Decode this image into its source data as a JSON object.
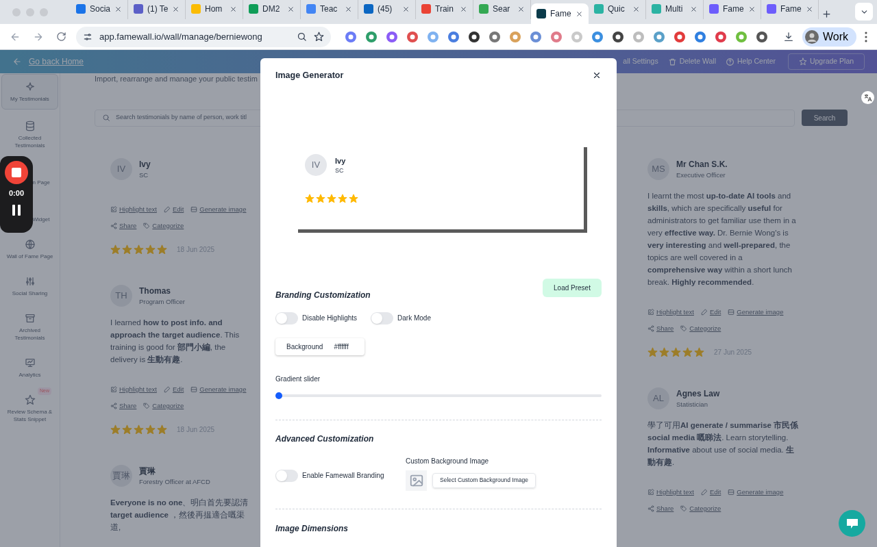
{
  "browser": {
    "tabs": [
      {
        "title": "Socia",
        "selected": false
      },
      {
        "title": "(1) Te",
        "selected": false
      },
      {
        "title": "Hom",
        "selected": false
      },
      {
        "title": "DM2",
        "selected": false
      },
      {
        "title": "Teac",
        "selected": false
      },
      {
        "title": "(45)",
        "selected": false
      },
      {
        "title": "Train",
        "selected": false
      },
      {
        "title": "Sear",
        "selected": false
      },
      {
        "title": "Fame",
        "selected": true
      },
      {
        "title": "Quic",
        "selected": false
      },
      {
        "title": "Multi",
        "selected": false
      },
      {
        "title": "Fame",
        "selected": false
      },
      {
        "title": "Fame",
        "selected": false
      }
    ],
    "address": "app.famewall.io/wall/manage/berniewong",
    "profile": "Work"
  },
  "app_header": {
    "back_link": "Go back Home",
    "actions": [
      {
        "kind": "settings",
        "label": "all Settings"
      },
      {
        "kind": "delete",
        "label": "Delete Wall"
      },
      {
        "kind": "help",
        "label": "Help Center"
      }
    ],
    "upgrade": "Upgrade Plan"
  },
  "sidebar": {
    "items": [
      {
        "label": "My Testimonials",
        "selected": true
      },
      {
        "label": "Collected Testimonials",
        "selected": false
      },
      {
        "label": "n Page",
        "selected": false
      },
      {
        "label": "Widget",
        "selected": false
      },
      {
        "label": "Wall of Fame Page",
        "selected": false
      },
      {
        "label": "Social Sharing",
        "selected": false
      },
      {
        "label": "Archived Testimonials",
        "selected": false
      },
      {
        "label": "Analytics",
        "selected": false
      },
      {
        "label": "Review Schema & Stats Snippet",
        "selected": false,
        "badge": "New"
      }
    ]
  },
  "recorder": {
    "time": "0:00"
  },
  "main": {
    "subtitle": "Import, rearrange and manage your public testim",
    "search": {
      "placeholder": "Search testimonials by name of person, work titl",
      "button": "Search"
    },
    "columns": [
      [
        {
          "initials": "IV",
          "name": "Ivy",
          "role": "SC",
          "actions": [
            {
              "kind": "highlight",
              "label": "Highlight text"
            },
            {
              "kind": "edit",
              "label": "Edit"
            },
            {
              "kind": "generate",
              "label": "Generate image"
            },
            {
              "kind": "share",
              "label": "Share"
            },
            {
              "kind": "categorize",
              "label": "Categorize"
            }
          ],
          "stars": 5,
          "date": "18 Jun 2025"
        },
        {
          "initials": "TH",
          "name": "Thomas",
          "role": "Program Officer",
          "text": "I learned **how to post info. and approach the target audience**. This training is good for **部門小編**, the delivery is **生動有趣**.",
          "actions": [
            {
              "kind": "highlight",
              "label": "Highlight text"
            },
            {
              "kind": "edit",
              "label": "Edit"
            },
            {
              "kind": "generate",
              "label": "Generate image"
            },
            {
              "kind": "share",
              "label": "Share"
            },
            {
              "kind": "categorize",
              "label": "Categorize"
            }
          ],
          "stars": 5,
          "date": "18 Jun 2025"
        },
        {
          "initials": "賈琳",
          "name": "賈琳",
          "role": "Forestry Officer at AFCD",
          "text": "**Everyone is no one**、明白首先要認清 **target audience** ，然後再揾適合嘅渠道,"
        }
      ],
      [
        {
          "initials": "MS",
          "name": "Mr Chan S.K.",
          "role": "Executive Officer",
          "text": "I learnt the most **up-to-date AI tools** and **skills**, which are specifically **useful** for administrators to get familiar use them in a very **effective way.** Dr. Bernie Wong's is **very interesting** and **well-prepared**, the topics are well covered in a **comprehensive way** within a short lunch break. **Highly recommended**.",
          "actions": [
            {
              "kind": "highlight",
              "label": "Highlight text"
            },
            {
              "kind": "edit",
              "label": "Edit"
            },
            {
              "kind": "generate",
              "label": "Generate image"
            },
            {
              "kind": "share",
              "label": "Share"
            },
            {
              "kind": "categorize",
              "label": "Categorize"
            }
          ],
          "stars": 5,
          "date": "27 Jun 2025"
        },
        {
          "initials": "AL",
          "name": "Agnes Law",
          "role": "Statistician",
          "text": "學了可用**AI generate / summarise 市民係 social media 嘅睇法**. Learn storytelling. **Informative** about use of social media. **生動有趣**.",
          "actions": [
            {
              "kind": "highlight",
              "label": "Highlight text"
            },
            {
              "kind": "edit",
              "label": "Edit"
            },
            {
              "kind": "generate",
              "label": "Generate image"
            },
            {
              "kind": "share",
              "label": "Share"
            },
            {
              "kind": "categorize",
              "label": "Categorize"
            }
          ]
        }
      ]
    ]
  },
  "modal": {
    "title": "Image Generator",
    "preview": {
      "initials": "IV",
      "name": "Ivy",
      "role": "SC",
      "stars": 5
    },
    "load_preset": "Load Preset",
    "branding": {
      "heading": "Branding Customization",
      "toggles": [
        {
          "label": "Disable Highlights",
          "on": false
        },
        {
          "label": "Dark Mode",
          "on": false
        }
      ],
      "background": {
        "label": "Background",
        "value": "#ffffff"
      },
      "gradient": {
        "label": "Gradient slider",
        "level": 0
      }
    },
    "advanced": {
      "heading": "Advanced Customization",
      "toggle": {
        "label": "Enable Famewall Branding",
        "on": false
      },
      "custom_bg": {
        "label": "Custom Background Image",
        "button": "Select Custom Background Image"
      }
    },
    "dimensions": {
      "heading": "Image Dimensions"
    }
  }
}
